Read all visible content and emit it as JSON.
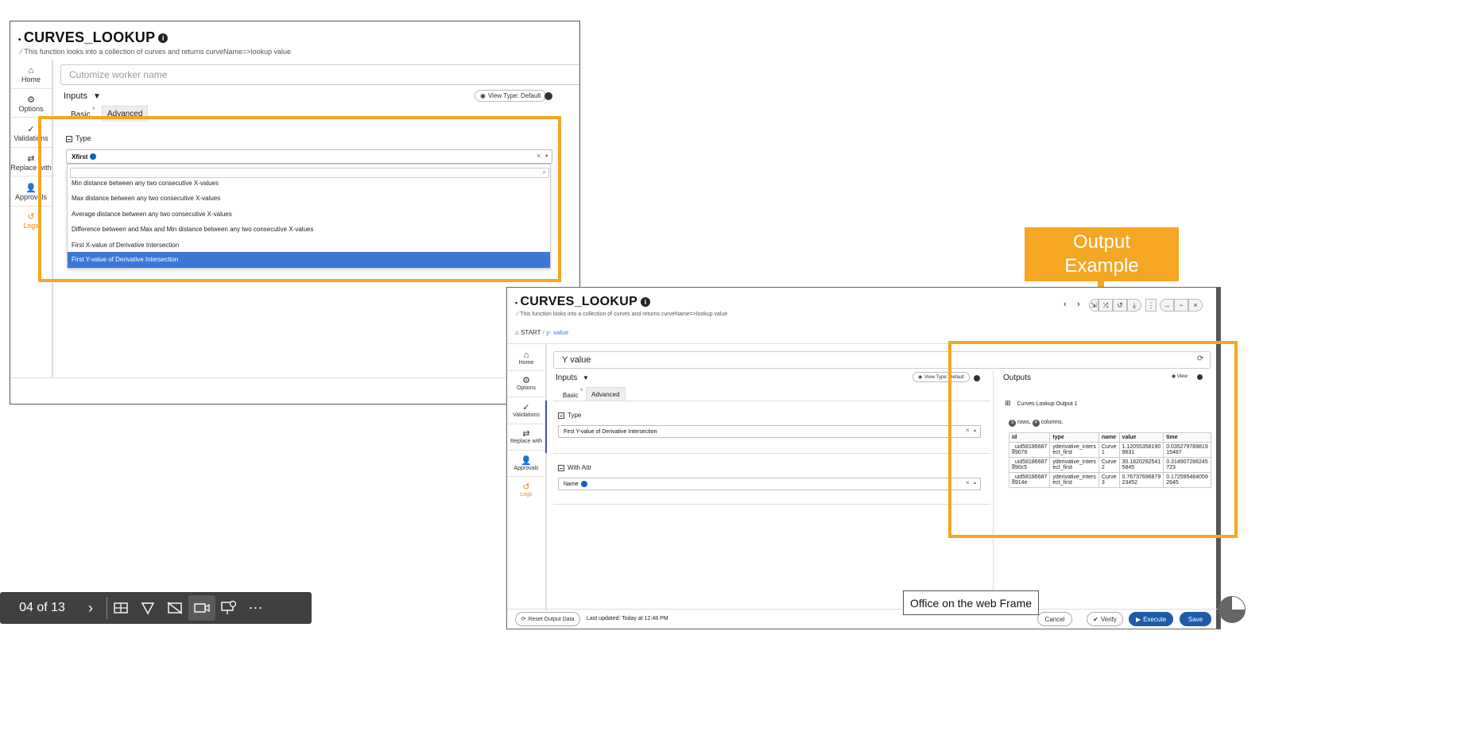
{
  "colors": {
    "highlight": "#f5a623",
    "primary": "#1f5ba8",
    "selected_option": "#3c78d8",
    "logs": "#e8891a"
  },
  "left_window": {
    "title": "CURVES_LOOKUP",
    "subtitle": "This function looks into a collection of curves and returns curveName=>lookup value",
    "sidebar": [
      {
        "label": "Home",
        "icon": "home-icon"
      },
      {
        "label": "Options",
        "icon": "gear-icon"
      },
      {
        "label": "Validations",
        "icon": "check-icon"
      },
      {
        "label": "Replace with",
        "icon": "swap-icon"
      },
      {
        "label": "Approvals",
        "icon": "user-check-icon"
      },
      {
        "label": "Logs",
        "icon": "history-icon"
      }
    ],
    "worker_name_placeholder": "Cutomize worker name",
    "inputs_label": "Inputs",
    "view_type_label": "View Type: Default",
    "tabs": {
      "basic": "Basic",
      "advanced": "Advanced"
    },
    "type_label": "Type",
    "selected_value": "Xfirst",
    "dropdown_options": [
      "Min distance between any two consecutive X-values",
      "Max distance between any two consecutive X-values",
      "Average distance between any two consecutive X-values",
      "Difference between and Max and Min distance between any two consecutive X-values",
      "First X-value of Derivative Intersection",
      "First Y-value of Derivative Intersection"
    ],
    "dropdown_selected_index": 5
  },
  "callout": {
    "line1": "Output",
    "line2": "Example"
  },
  "right_window": {
    "title": "CURVES_LOOKUP",
    "subtitle": "This function looks into a collection of curves and returns curveName=>lookup value",
    "breadcrumb": {
      "start": "START",
      "current": "y- value"
    },
    "sidebar": [
      {
        "label": "Home",
        "icon": "home-icon"
      },
      {
        "label": "Options",
        "icon": "gear-icon"
      },
      {
        "label": "Validations",
        "icon": "check-icon"
      },
      {
        "label": "Replace with",
        "icon": "swap-icon"
      },
      {
        "label": "Approvals",
        "icon": "user-check-icon"
      },
      {
        "label": "Logs",
        "icon": "history-icon"
      }
    ],
    "worker_name": "Y value",
    "inputs_label": "Inputs",
    "view_type_label": "View Type: Default",
    "tabs": {
      "basic": "Basic",
      "advanced": "Advanced"
    },
    "type_label": "Type",
    "type_value": "First Y-value of Derivative Intersection",
    "with_attr_label": "With Attr",
    "with_attr_value": "Name",
    "outputs_label": "Outputs",
    "outputs_view_label": "View",
    "output_name": "Curves Lookup Output 1",
    "rows_count": "3",
    "rows_label": "rows,",
    "columns_count": "4",
    "columns_label": "columns.",
    "table": {
      "columns": [
        "id",
        "type",
        "name",
        "value",
        "time"
      ],
      "rows": [
        [
          "_uid58186687 89076",
          "yderivative_inters ect_first",
          "Curve 1",
          "1.12055358190 9631",
          "0.035279789819 15487"
        ],
        [
          "_uid58186687 890c5",
          "yderivative_inters ect_first",
          "Curve 2",
          "30.1820292541 5845",
          "0.314907286245 723"
        ],
        [
          "_uid58186687 8914e",
          "yderivative_inters ect_first",
          "Curve 3",
          "0.76737696879 23452",
          "0.172595484059 2645"
        ]
      ]
    },
    "footer": {
      "reset_label": "Reset Output Data",
      "last_updated": "Last updated: Today at 12:48 PM",
      "cancel": "Cancel",
      "verify": "Verify",
      "execute": "Execute",
      "save": "Save"
    }
  },
  "slideshow": {
    "counter": "04 of 13"
  },
  "tooltip": "Office on the web Frame"
}
